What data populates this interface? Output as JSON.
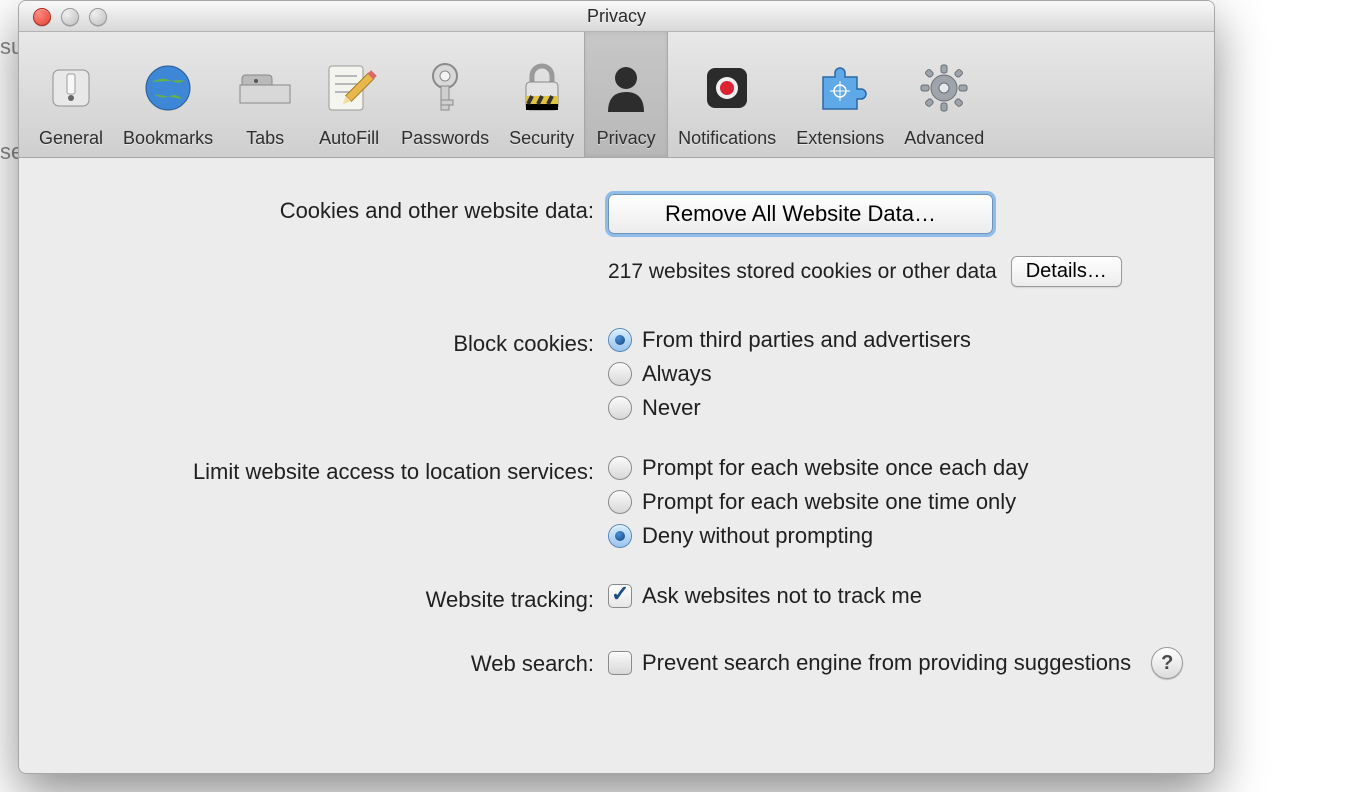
{
  "behind": {
    "line1": "su",
    "line2": "se"
  },
  "window": {
    "title": "Privacy"
  },
  "toolbar": {
    "items": [
      {
        "id": "general",
        "label": "General"
      },
      {
        "id": "bookmarks",
        "label": "Bookmarks"
      },
      {
        "id": "tabs",
        "label": "Tabs"
      },
      {
        "id": "autofill",
        "label": "AutoFill"
      },
      {
        "id": "passwords",
        "label": "Passwords"
      },
      {
        "id": "security",
        "label": "Security"
      },
      {
        "id": "privacy",
        "label": "Privacy",
        "selected": true
      },
      {
        "id": "notifications",
        "label": "Notifications"
      },
      {
        "id": "extensions",
        "label": "Extensions"
      },
      {
        "id": "advanced",
        "label": "Advanced"
      }
    ]
  },
  "sections": {
    "cookies": {
      "label": "Cookies and other website data:",
      "remove_button": "Remove All Website Data…",
      "status": "217 websites stored cookies or other data",
      "details_button": "Details…"
    },
    "block_cookies": {
      "label": "Block cookies:",
      "options": [
        {
          "label": "From third parties and advertisers",
          "checked": true
        },
        {
          "label": "Always",
          "checked": false
        },
        {
          "label": "Never",
          "checked": false
        }
      ]
    },
    "location": {
      "label": "Limit website access to location services:",
      "options": [
        {
          "label": "Prompt for each website once each day",
          "checked": false
        },
        {
          "label": "Prompt for each website one time only",
          "checked": false
        },
        {
          "label": "Deny without prompting",
          "checked": true
        }
      ]
    },
    "tracking": {
      "label": "Website tracking:",
      "option": {
        "label": "Ask websites not to track me",
        "checked": true
      }
    },
    "websearch": {
      "label": "Web search:",
      "option": {
        "label": "Prevent search engine from providing suggestions",
        "checked": false
      },
      "help": "?"
    }
  }
}
